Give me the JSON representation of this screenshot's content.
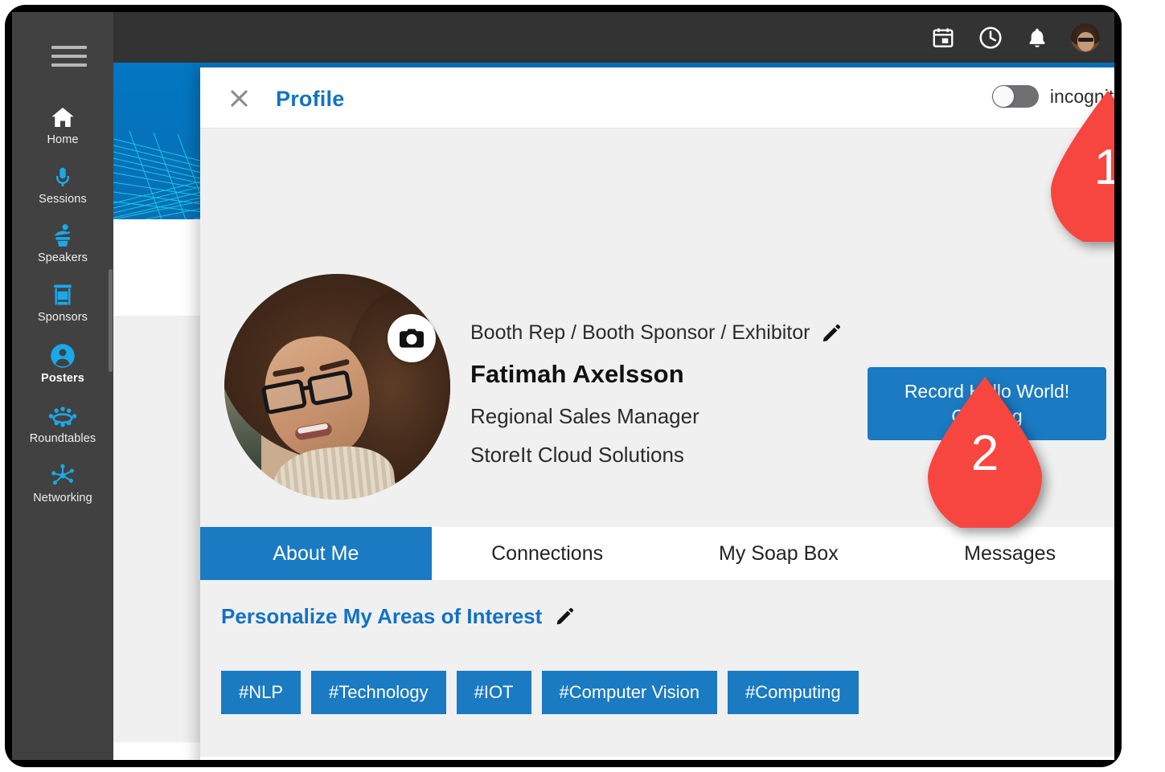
{
  "sidebar": {
    "menu_icon": "hamburger-icon",
    "items": [
      {
        "label": "Home",
        "icon": "home-icon",
        "active": false
      },
      {
        "label": "Sessions",
        "icon": "microphone-icon",
        "active": false
      },
      {
        "label": "Speakers",
        "icon": "podium-icon",
        "active": false
      },
      {
        "label": "Sponsors",
        "icon": "booth-icon",
        "active": false
      },
      {
        "label": "Posters",
        "icon": "person-icon",
        "active": true
      },
      {
        "label": "Roundtables",
        "icon": "roundtable-icon",
        "active": false
      },
      {
        "label": "Networking",
        "icon": "network-icon",
        "active": false
      }
    ]
  },
  "topbar": {
    "icons": [
      {
        "name": "calendar-icon"
      },
      {
        "name": "clock-icon"
      },
      {
        "name": "bell-icon"
      },
      {
        "name": "user-avatar"
      }
    ]
  },
  "modal": {
    "close_icon": "close-icon",
    "title": "Profile",
    "incognito": {
      "label": "incognito",
      "state": "off"
    },
    "profile": {
      "photo_alt": "profile-photo",
      "camera_icon": "camera-icon",
      "role": "Booth Rep / Booth Sponsor / Exhibitor",
      "role_edit_icon": "pencil-icon",
      "name": "Fatimah Axelsson",
      "job_title": "Regional Sales Manager",
      "company": "StoreIt Cloud Solutions",
      "record_button": "Record Hello World! Greeting"
    },
    "tabs": [
      {
        "label": "About Me",
        "active": true
      },
      {
        "label": "Connections",
        "active": false
      },
      {
        "label": "My Soap Box",
        "active": false
      },
      {
        "label": "Messages",
        "active": false
      }
    ],
    "interests": {
      "title": "Personalize My Areas of Interest",
      "edit_icon": "pencil-icon",
      "chips": [
        "#NLP",
        "#Technology",
        "#IOT",
        "#Computer Vision",
        "#Computing"
      ]
    }
  },
  "annotations": [
    {
      "number": "1",
      "target": "incognito-toggle"
    },
    {
      "number": "2",
      "target": "record-hello-world-greeting-button"
    }
  ],
  "colors": {
    "accent_blue": "#1a7ac2",
    "link_blue": "#1272c4",
    "sidebar_icon_blue": "#1aa9e8",
    "sidebar_bg": "#414141",
    "topbar_bg": "#333333",
    "marker_red": "#f7463f",
    "panel_grey": "#f0f0f0"
  }
}
